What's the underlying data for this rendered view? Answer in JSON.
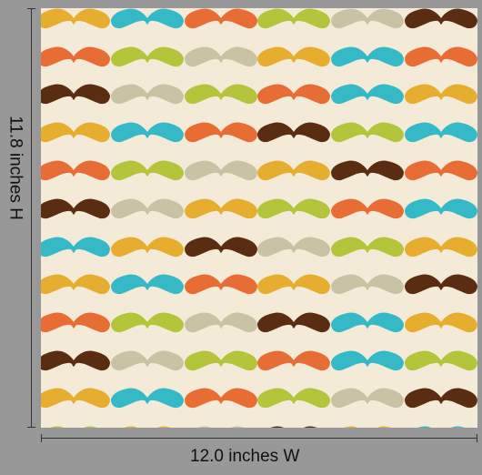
{
  "labels": {
    "width": "12.0 inches W",
    "height": "11.8 inches H"
  },
  "colors": {
    "background": "#f3ead7",
    "orange": "#e76d35",
    "yellow": "#e7ad2f",
    "teal": "#36b9c6",
    "olive": "#b4c43b",
    "gray": "#c9c3a5",
    "brown": "#5a2d12"
  },
  "pattern": {
    "rows": [
      [
        "yellow",
        "teal",
        "orange",
        "olive",
        "gray",
        "brown"
      ],
      [
        "orange",
        "olive",
        "gray",
        "yellow",
        "teal",
        "orange"
      ],
      [
        "brown",
        "gray",
        "olive",
        "orange",
        "teal",
        "yellow"
      ],
      [
        "yellow",
        "teal",
        "orange",
        "brown",
        "olive",
        "teal"
      ],
      [
        "orange",
        "olive",
        "gray",
        "yellow",
        "brown",
        "orange"
      ],
      [
        "brown",
        "gray",
        "yellow",
        "olive",
        "orange",
        "teal"
      ],
      [
        "teal",
        "yellow",
        "brown",
        "gray",
        "olive",
        "yellow"
      ],
      [
        "yellow",
        "teal",
        "orange",
        "yellow",
        "gray",
        "brown"
      ],
      [
        "orange",
        "olive",
        "gray",
        "brown",
        "teal",
        "yellow"
      ],
      [
        "brown",
        "gray",
        "olive",
        "orange",
        "teal",
        "olive"
      ],
      [
        "yellow",
        "teal",
        "orange",
        "olive",
        "gray",
        "brown"
      ],
      [
        "olive",
        "yellow",
        "gray",
        "brown",
        "yellow",
        "teal"
      ]
    ]
  }
}
